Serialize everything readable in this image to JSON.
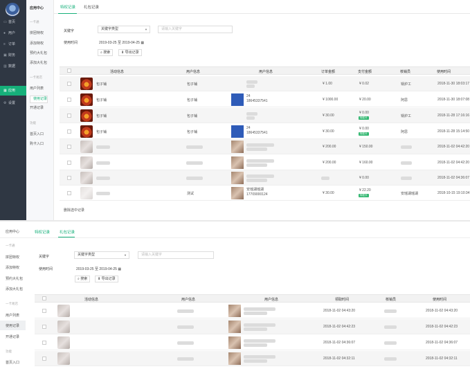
{
  "sidebar": {
    "items": [
      {
        "label": "首页",
        "icon": "home-icon"
      },
      {
        "label": "用户",
        "icon": "user-icon"
      },
      {
        "label": "订单",
        "icon": "list-icon"
      },
      {
        "label": "财务",
        "icon": "money-icon"
      },
      {
        "label": "数据",
        "icon": "chart-icon"
      },
      {
        "label": "应用",
        "icon": "grid-icon",
        "active": true
      },
      {
        "label": "设置",
        "icon": "gear-icon"
      }
    ]
  },
  "subnav": {
    "title": "应用中心",
    "groups": [
      {
        "name": "一卡通",
        "items": [
          "拼团特权",
          "添加特权",
          "预约大礼包",
          "添加大礼包"
        ]
      },
      {
        "name": "一卡易店",
        "items": [
          "用户列表",
          "使用记录",
          "开通记录"
        ]
      },
      {
        "name": "功能",
        "items": [
          "首页入口",
          "购卡入口"
        ]
      }
    ],
    "selected": "使用记录"
  },
  "tabs": [
    "特权记录",
    "礼包记录"
  ],
  "filters": {
    "keyword_label": "关键字",
    "keyword_type": "关键字类型",
    "keyword_placeholder": "请输入关键字",
    "time_label": "使用时间",
    "date_range": "2019-03-25 至 2019-04-25",
    "search_btn": "搜索",
    "export_btn": "导出记录"
  },
  "table1": {
    "headers": [
      "活动信息",
      "用户信息",
      "用户信息",
      "订单金额",
      "支付金额",
      "核销员",
      "使用时间"
    ],
    "rows": [
      {
        "title": "包子铺",
        "user": "包子铺",
        "phone": "",
        "amount": "¥ 1.00",
        "pay": "¥ 0.02",
        "badge": "",
        "staff": "锅炉工",
        "time": "2018-11-30 18:03:17"
      },
      {
        "title": "包子铺",
        "user": "包子铺",
        "phone": "24\n18645337541",
        "amount": "¥ 1000.00",
        "pay": "¥ 20.00",
        "badge": "",
        "staff": "阿思",
        "time": "2018-11-30 18:07:08"
      },
      {
        "title": "包子铺",
        "user": "包子铺",
        "phone": "",
        "amount": "¥ 30.00",
        "pay": "¥ 0.00",
        "badge": "特权卡",
        "staff": "锅炉工",
        "time": "2018-11-28 17:16:16"
      },
      {
        "title": "包子铺",
        "user": "包子铺",
        "phone": "24\n18645337541",
        "amount": "¥ 30.00",
        "pay": "¥ 0.00",
        "badge": "特权卡",
        "staff": "阿思",
        "time": "2018-11-28 15:14:50"
      },
      {
        "title": "",
        "user": "",
        "phone": "",
        "amount": "¥ 200.00",
        "pay": "¥ 150.00",
        "badge": "",
        "staff": "",
        "time": "2018-11-02 04:42:20"
      },
      {
        "title": "",
        "user": "",
        "phone": "",
        "amount": "¥ 200.00",
        "pay": "¥ 160.00",
        "badge": "",
        "staff": "",
        "time": "2018-11-02 04:42:20"
      },
      {
        "title": "",
        "user": "",
        "phone": "",
        "amount": "",
        "pay": "¥ 0.00",
        "badge": "",
        "staff": "",
        "time": "2018-11-02 04:36:07"
      },
      {
        "title": "",
        "user": "测试",
        "phone": "安瑶湖瑶湖\n17709000124",
        "amount": "¥ 30.00",
        "pay": "¥ 22.20",
        "badge": "特权卡",
        "staff": "安瑶湖瑶湖",
        "time": "2018-10-15 19:10:34"
      }
    ],
    "footer": "删除选中记录"
  },
  "bottom": {
    "title": "应用中心",
    "tabs": [
      "特权记录",
      "礼包记录"
    ],
    "subgroups": [
      {
        "name": "一卡通",
        "items": [
          "拼团特权",
          "添加特权",
          "预约大礼包",
          "添加大礼包"
        ]
      },
      {
        "name": "一卡易店",
        "items": [
          "用户列表",
          "使用记录",
          "开通记录"
        ]
      },
      {
        "name": "功能",
        "items": [
          "首页入口"
        ]
      }
    ],
    "headers": [
      "活动信息",
      "用户信息",
      "用户信息",
      "领取时间",
      "核销员",
      "使用时间"
    ],
    "rows": [
      {
        "claim": "2018-11-02 04:43:20",
        "use": "2018-11-02 04:43:20"
      },
      {
        "claim": "2018-11-02 04:42:23",
        "use": "2018-11-02 04:42:23"
      },
      {
        "claim": "2018-11-02 04:36:07",
        "use": "2018-11-02 04:36:07"
      },
      {
        "claim": "2018-11-02 04:32:11",
        "use": "2018-11-02 04:32:11"
      }
    ]
  }
}
